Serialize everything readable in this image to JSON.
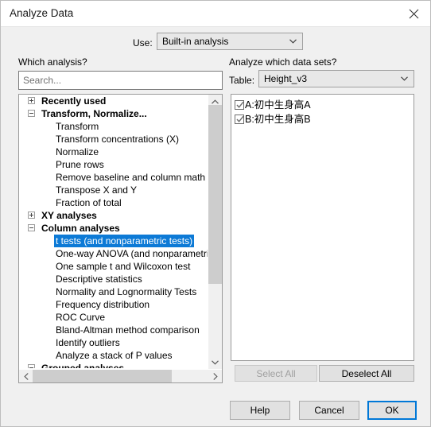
{
  "window": {
    "title": "Analyze Data",
    "close_icon": "close-icon"
  },
  "use_row": {
    "label": "Use:",
    "value": "Built-in analysis"
  },
  "left_panel": {
    "heading": "Which analysis?",
    "search_placeholder": "Search...",
    "search_value": "",
    "tree": [
      {
        "label": "Recently used",
        "type": "group",
        "expanded": false
      },
      {
        "label": "Transform, Normalize...",
        "type": "group",
        "expanded": true
      },
      {
        "label": "Transform",
        "type": "leaf",
        "selected": false
      },
      {
        "label": "Transform concentrations (X)",
        "type": "leaf",
        "selected": false
      },
      {
        "label": "Normalize",
        "type": "leaf",
        "selected": false
      },
      {
        "label": "Prune rows",
        "type": "leaf",
        "selected": false
      },
      {
        "label": "Remove baseline and column math",
        "type": "leaf",
        "selected": false
      },
      {
        "label": "Transpose X and Y",
        "type": "leaf",
        "selected": false
      },
      {
        "label": "Fraction of total",
        "type": "leaf",
        "selected": false
      },
      {
        "label": "XY analyses",
        "type": "group",
        "expanded": false
      },
      {
        "label": "Column analyses",
        "type": "group",
        "expanded": true
      },
      {
        "label": "t tests (and nonparametric tests)",
        "type": "leaf",
        "selected": true
      },
      {
        "label": "One-way ANOVA (and nonparametric or",
        "type": "leaf",
        "selected": false
      },
      {
        "label": "One sample t and Wilcoxon test",
        "type": "leaf",
        "selected": false
      },
      {
        "label": "Descriptive statistics",
        "type": "leaf",
        "selected": false
      },
      {
        "label": "Normality and Lognormality Tests",
        "type": "leaf",
        "selected": false
      },
      {
        "label": "Frequency distribution",
        "type": "leaf",
        "selected": false
      },
      {
        "label": "ROC Curve",
        "type": "leaf",
        "selected": false
      },
      {
        "label": "Bland-Altman method comparison",
        "type": "leaf",
        "selected": false
      },
      {
        "label": "Identify outliers",
        "type": "leaf",
        "selected": false
      },
      {
        "label": "Analyze a stack of P values",
        "type": "leaf",
        "selected": false
      },
      {
        "label": "Grouped analyses",
        "type": "group",
        "expanded": true,
        "clipped": true
      }
    ]
  },
  "right_panel": {
    "heading": "Analyze which data sets?",
    "table_label": "Table:",
    "table_value": "Height_v3",
    "datasets": [
      {
        "label": "A:初中生身高A",
        "checked": true
      },
      {
        "label": "B:初中生身高B",
        "checked": true
      }
    ],
    "select_all_label": "Select All",
    "select_all_disabled": true,
    "deselect_all_label": "Deselect All"
  },
  "footer": {
    "help_label": "Help",
    "cancel_label": "Cancel",
    "ok_label": "OK"
  },
  "colors": {
    "selection_blue": "#0d7ad6",
    "default_button_blue": "#0078d7",
    "dialog_bg": "#f0f0f0",
    "field_bg": "#ffffff",
    "combo_bg": "#e8e8e8"
  }
}
